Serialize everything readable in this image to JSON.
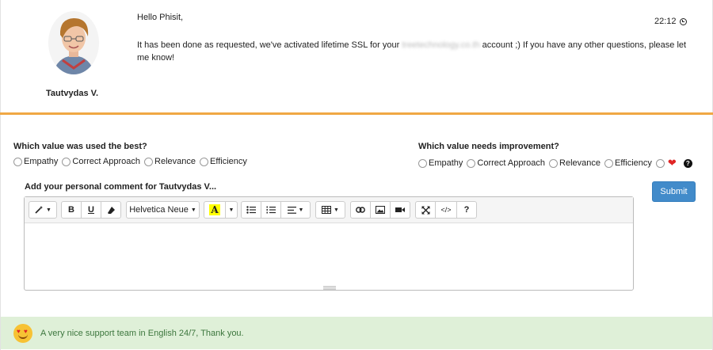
{
  "message": {
    "agent_name": "Tautvydas V.",
    "greeting": "Hello Phisit,",
    "body_before": "It has been done as requested, we've activated lifetime SSL for your ",
    "body_redacted": "treetechnology.co.th",
    "body_after": " account ;) If you have any other questions, please let me know!",
    "time": "22:12"
  },
  "rating": {
    "best": {
      "question": "Which value was used the best?",
      "options": [
        "Empathy",
        "Correct Approach",
        "Relevance",
        "Efficiency"
      ]
    },
    "improve": {
      "question": "Which value needs improvement?",
      "options": [
        "Empathy",
        "Correct Approach",
        "Relevance",
        "Efficiency"
      ]
    }
  },
  "comment": {
    "label": "Add your personal comment for Tautvydas V...",
    "submit_label": "Submit",
    "toolbar": {
      "bold": "B",
      "underline": "U",
      "font_family": "Helvetica Neue",
      "font_color": "A",
      "help": "?",
      "code": "</>"
    }
  },
  "note": {
    "text": "A very nice support team in English 24/7, Thank you."
  },
  "colors": {
    "accent_divider": "#f0a844",
    "submit": "#428bca",
    "note_bg": "#dff0d8",
    "note_text": "#3c763d"
  }
}
